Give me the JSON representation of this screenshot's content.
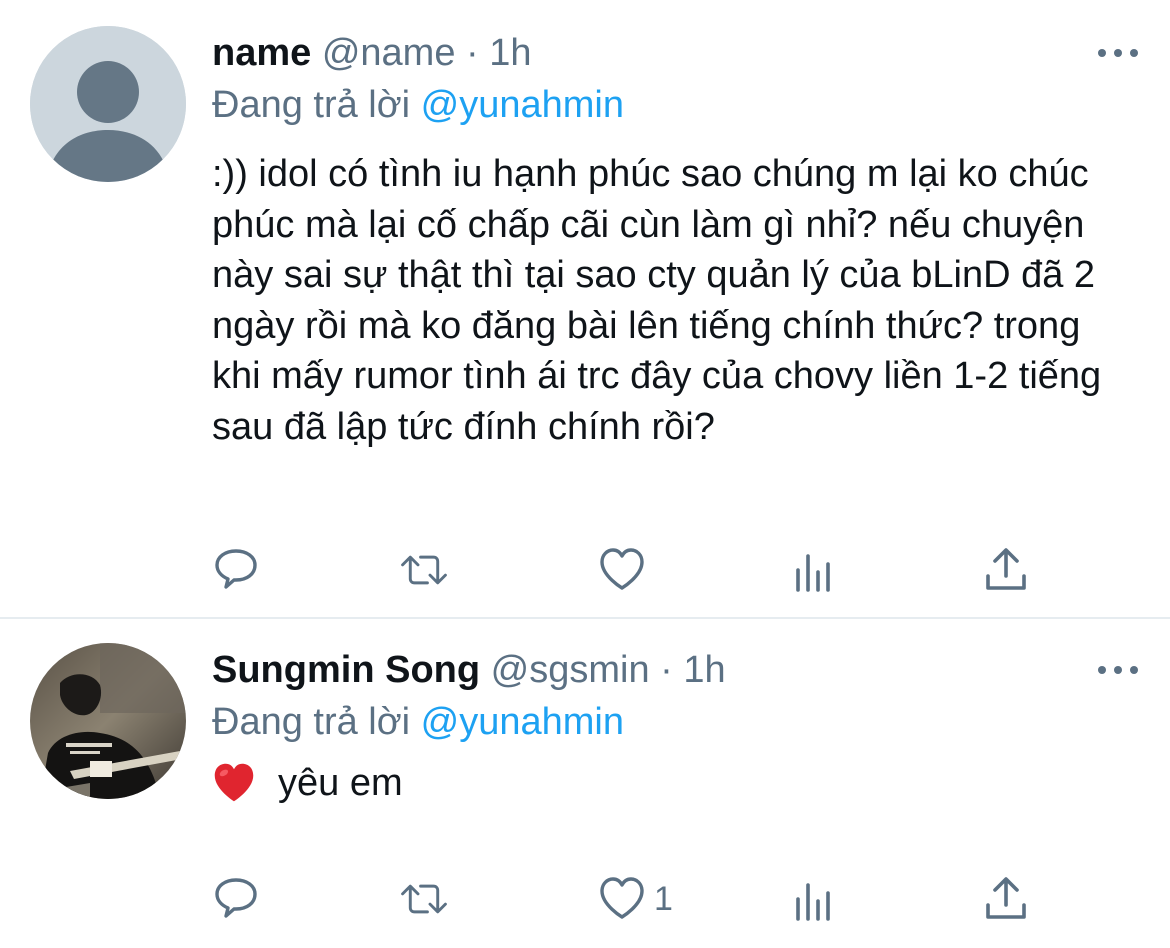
{
  "tweets": [
    {
      "display_name": "name",
      "handle": "@name",
      "time": "1h",
      "separator": "·",
      "reply_prefix": "Đang trả lời",
      "reply_to": "@yunahmin",
      "text": ":)) idol có tình iu hạnh phúc sao chúng m lại ko chúc phúc mà lại cố chấp cãi cùn làm gì nhỉ? nếu chuyện này sai sự thật thì tại sao cty quản lý của bLinD đã 2 ngày rồi mà ko đăng bài lên tiếng chính thức? trong khi mấy rumor tình ái trc đây của chovy liền 1-2 tiếng sau đã lập tức đính chính rồi?",
      "like_count": ""
    },
    {
      "display_name": "Sungmin Song",
      "handle": "@sgsmin",
      "time": "1h",
      "separator": "·",
      "reply_prefix": "Đang trả lời",
      "reply_to": "@yunahmin",
      "emoji": "❤️",
      "text": "yêu em",
      "like_count": "1"
    }
  ],
  "icons": [
    "reply-icon",
    "retweet-icon",
    "like-icon",
    "analytics-icon",
    "share-icon",
    "more-icon"
  ],
  "colors": {
    "text": "#0f1419",
    "muted": "#5b7083",
    "accent": "#1da1f2",
    "divider": "#e6ecf0"
  }
}
